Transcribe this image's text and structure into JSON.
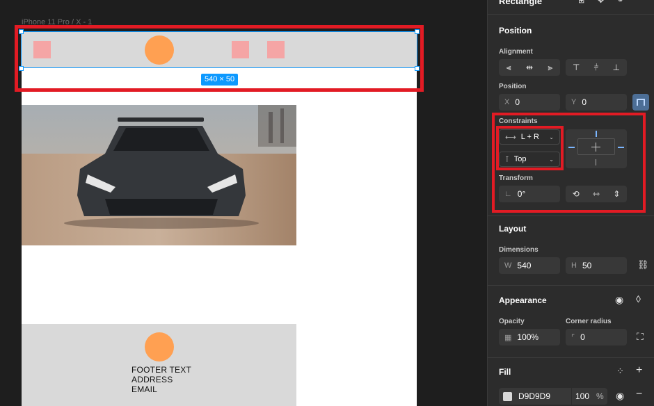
{
  "canvas": {
    "frame_label": "iPhone 11 Pro / X - 1",
    "selection_size": "540 × 50",
    "footer_lines": [
      "FOOTER TEXT",
      "ADDRESS",
      "EMAIL"
    ]
  },
  "panel": {
    "top_title": "Rectangle",
    "position": {
      "title": "Position",
      "alignment_label": "Alignment",
      "position_label": "Position",
      "x_label": "X",
      "x_value": "0",
      "y_label": "Y",
      "y_value": "0"
    },
    "constraints": {
      "label": "Constraints",
      "horizontal": "L + R",
      "vertical": "Top"
    },
    "transform": {
      "label": "Transform",
      "rotation": "0°"
    },
    "layout": {
      "title": "Layout",
      "dimensions_label": "Dimensions",
      "w_label": "W",
      "w_value": "540",
      "h_label": "H",
      "h_value": "50"
    },
    "appearance": {
      "title": "Appearance",
      "opacity_label": "Opacity",
      "opacity_value": "100%",
      "radius_label": "Corner radius",
      "radius_value": "0"
    },
    "fill": {
      "title": "Fill",
      "hex": "D9D9D9",
      "opacity": "100",
      "percent": "%"
    }
  },
  "colors": {
    "selection": "#0d99ff",
    "highlight": "#e21b24",
    "fill": "#D9D9D9"
  }
}
